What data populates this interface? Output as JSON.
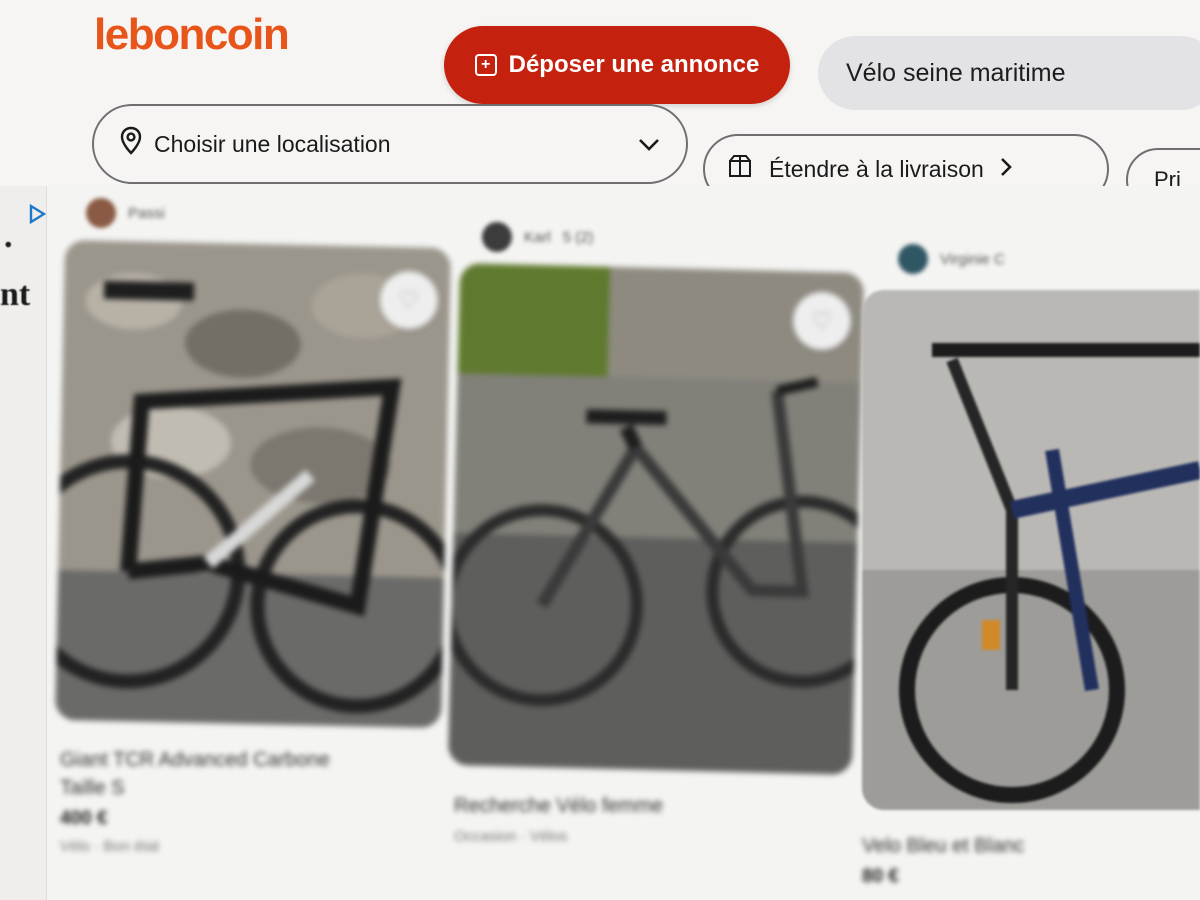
{
  "colors": {
    "brand": "#ec5a13",
    "deposit_button": "#c5210f",
    "search_pill": "#e3e3e6"
  },
  "header": {
    "logo": "leboncoin",
    "deposit_label": "Déposer une annonce",
    "search_value": "Vélo seine maritime",
    "location_placeholder": "Choisir une localisation",
    "delivery_label": "Étendre à la livraison",
    "price_label": "Pri"
  },
  "side": {
    "fragment_1": ".",
    "fragment_2": "nt"
  },
  "listings": [
    {
      "seller": "Passi",
      "title": "Giant TCR Advanced Carbone",
      "title_2": "Taille S",
      "price": "400 €",
      "meta": "Vélo · Bon état"
    },
    {
      "seller": "Karl",
      "rating": "5 (2)",
      "title": "Recherche Vélo femme",
      "price": "",
      "meta": "Occasion · Vélos"
    },
    {
      "seller": "Virginie C",
      "title": "Velo Bleu et Blanc",
      "price": "80 €",
      "meta": ""
    }
  ]
}
